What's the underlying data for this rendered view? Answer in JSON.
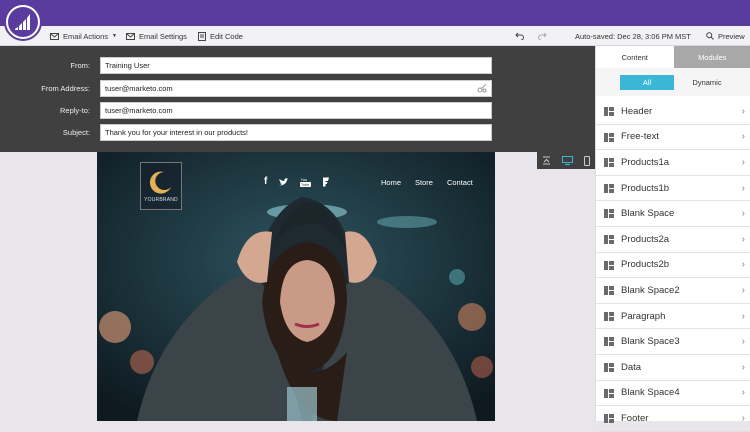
{
  "toolbar": {
    "email_actions": "Email Actions",
    "email_settings": "Email Settings",
    "edit_code": "Edit Code",
    "autosave": "Auto-saved: Dec 28, 3:06 PM MST",
    "preview": "Preview"
  },
  "header_fields": [
    {
      "label": "From:",
      "value": "Training User"
    },
    {
      "label": "From Address:",
      "value": "tuser@marketo.com"
    },
    {
      "label": "Reply-to:",
      "value": "tuser@marketo.com"
    },
    {
      "label": "Subject:",
      "value": "Thank you for your interest in our products!"
    }
  ],
  "email": {
    "brand": "YOURBRAND",
    "social": [
      "f",
      "twitter",
      "youtube",
      "foursquare"
    ],
    "nav": [
      "Home",
      "Store",
      "Contact"
    ]
  },
  "sidebar": {
    "tabs": [
      "Content",
      "Modules"
    ],
    "subtabs": [
      "All",
      "Dynamic"
    ],
    "modules": [
      "Header",
      "Free-text",
      "Products1a",
      "Products1b",
      "Blank Space",
      "Products2a",
      "Products2b",
      "Blank Space2",
      "Paragraph",
      "Blank Space3",
      "Data",
      "Blank Space4",
      "Footer"
    ]
  },
  "colors": {
    "brand_purple": "#5a3c9e",
    "accent_blue": "#3ab6d6",
    "header_panel": "#404040"
  }
}
